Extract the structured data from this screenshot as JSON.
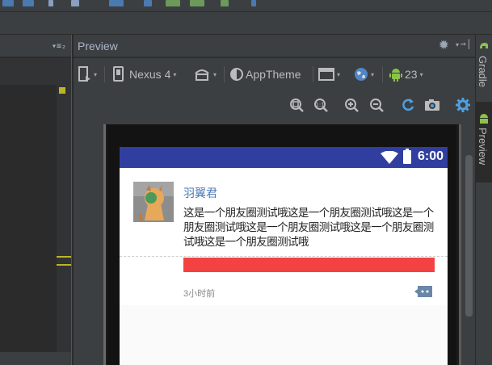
{
  "preview": {
    "title": "Preview"
  },
  "toolbar": {
    "device": "Nexus 4",
    "theme": "AppTheme",
    "api_level": "23"
  },
  "phone": {
    "status_time": "6:00",
    "post": {
      "username": "羽翼君",
      "text": "这是一个朋友圈测试哦这是一个朋友圈测试哦这是一个朋友圈测试哦这是一个朋友圈测试哦这是一个朋友圈测试哦这是一个朋友圈测试哦",
      "time_ago": "3小时前"
    }
  },
  "side_tabs": {
    "gradle": "Gradle",
    "preview": "Preview"
  },
  "colors": {
    "status_bar": "#303f9f",
    "username": "#4e7ab8",
    "red_bar": "#f44242",
    "ide_bg": "#3c3f41"
  }
}
